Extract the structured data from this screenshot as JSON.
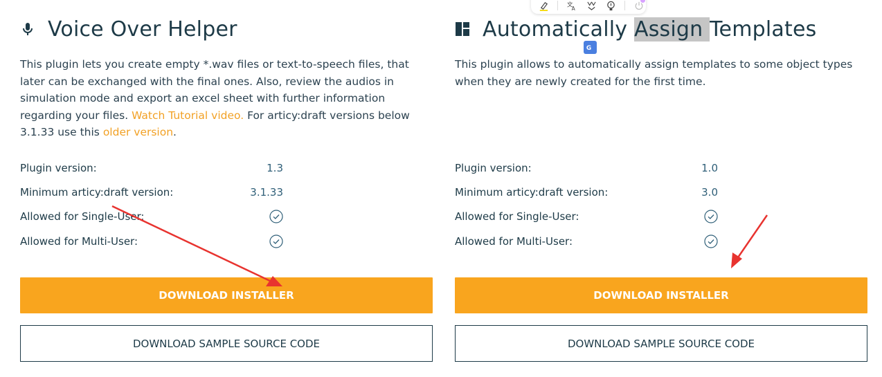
{
  "cards": [
    {
      "icon": "microphone-icon",
      "title": "Voice Over Helper",
      "description": {
        "text": "This plugin lets you create empty *.wav files or text-to-speech files, that later can be exchanged with the final ones. Also, review the audios in simulation mode and export an excel sheet with further information regarding your files. ",
        "tutorial_link": "Watch Tutorial video.",
        "middle": " For articy:draft versions below 3.1.33 use this ",
        "older_link": "older version",
        "end": "."
      },
      "specs": {
        "plugin_version_label": "Plugin version:",
        "plugin_version": "1.3",
        "min_version_label": "Minimum articy:draft version:",
        "min_version": "3.1.33",
        "single_user_label": "Allowed for Single-User:",
        "single_user_allowed": true,
        "multi_user_label": "Allowed for Multi-User:",
        "multi_user_allowed": true
      },
      "download_installer": "DOWNLOAD INSTALLER",
      "download_source": "DOWNLOAD SAMPLE SOURCE CODE"
    },
    {
      "icon": "dashboard-icon",
      "title_before": "Automatically ",
      "title_highlight": "Assign ",
      "title_after": "Templates",
      "description": {
        "text": "This plugin allows to automatically assign templates to some object types when they are newly created for the first time."
      },
      "specs": {
        "plugin_version_label": "Plugin version:",
        "plugin_version": "1.0",
        "min_version_label": "Minimum articy:draft version:",
        "min_version": "3.0",
        "single_user_label": "Allowed for Single-User:",
        "single_user_allowed": true,
        "multi_user_label": "Allowed for Multi-User:",
        "multi_user_allowed": true
      },
      "download_installer": "DOWNLOAD INSTALLER",
      "download_source": "DOWNLOAD SAMPLE SOURCE CODE"
    }
  ],
  "selection_toolbar": {
    "buttons": [
      "highlighter-icon",
      "translate-icon",
      "summarize-icon",
      "explain-icon",
      "power-icon"
    ]
  },
  "translate_popup_icon": "google-translate-icon",
  "colors": {
    "accent": "#f9a51e",
    "link": "#f2a125",
    "text": "#1d3a47",
    "value": "#2f5f78",
    "annotation_arrow": "#e8332f"
  }
}
